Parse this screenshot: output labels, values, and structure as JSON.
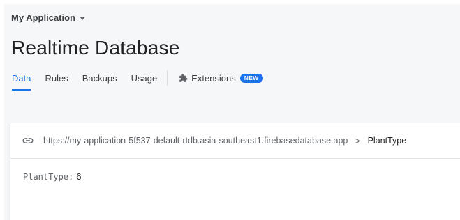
{
  "header": {
    "project_name": "My Application",
    "page_title": "Realtime Database"
  },
  "tabs": [
    {
      "label": "Data",
      "active": true
    },
    {
      "label": "Rules",
      "active": false
    },
    {
      "label": "Backups",
      "active": false
    },
    {
      "label": "Usage",
      "active": false
    },
    {
      "label": "Extensions",
      "badge": "NEW",
      "icon": "extensions-icon"
    }
  ],
  "database": {
    "url": "https://my-application-5f537-default-rtdb.asia-southeast1.firebasedatabase.app",
    "separator": ">",
    "current_node": "PlantType",
    "entry_key": "PlantType",
    "entry_colon": ":",
    "entry_value": "6"
  },
  "colors": {
    "accent": "#1a73e8",
    "background": "#f6f7f9",
    "text_primary": "#202124",
    "text_secondary": "#5f6368"
  }
}
